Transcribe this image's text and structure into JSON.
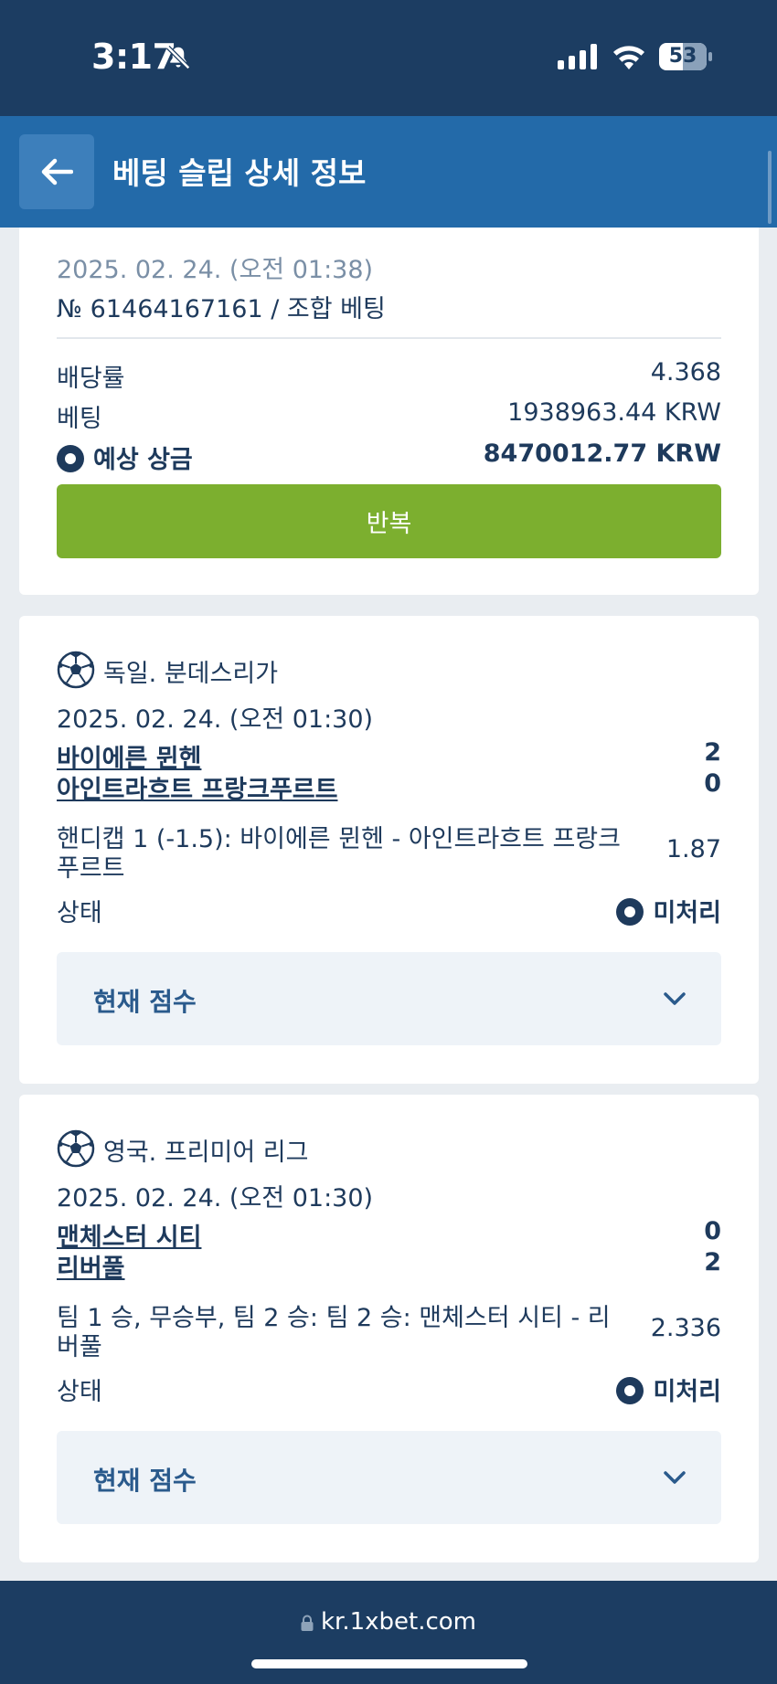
{
  "status_bar": {
    "time": "3:17",
    "battery": "53"
  },
  "nav": {
    "title": "베팅 슬립 상세 정보"
  },
  "summary": {
    "datetime": "2025. 02. 24. (오전 01:38)",
    "bet_number": "№ 61464167161 / 조합 베팅",
    "odds_label": "배당률",
    "odds_value": "4.368",
    "stake_label": "베팅",
    "stake_value": "1938963.44 KRW",
    "payout_label": "예상 상금",
    "payout_value": "8470012.77 KRW",
    "repeat_label": "반복"
  },
  "events": [
    {
      "league": "독일. 분데스리가",
      "datetime": "2025. 02. 24. (오전 01:30)",
      "team1": "바이에른 뮌헨",
      "score1": "2",
      "team2": "아인트라흐트 프랑크푸르트",
      "score2": "0",
      "market_line1": "핸디캡 1 (-1.5): 바이에른 뮌헨 - 아인트라흐트 프랑크",
      "market_line2": "푸르트",
      "odds": "1.87",
      "status_label": "상태",
      "status_value": "미처리",
      "score_toggle": "현재 점수"
    },
    {
      "league": "영국. 프리미어 리그",
      "datetime": "2025. 02. 24. (오전 01:30)",
      "team1": "맨체스터 시티",
      "score1": "0",
      "team2": "리버풀",
      "score2": "2",
      "market_line1": "팀 1 승, 무승부, 팀 2 승: 팀 2 승: 맨체스터 시티 - 리",
      "market_line2": "버풀",
      "odds": "2.336",
      "status_label": "상태",
      "status_value": "미처리",
      "score_toggle": "현재 점수"
    }
  ],
  "browser": {
    "url": "kr.1xbet.com"
  },
  "colors": {
    "header": "#1c3d62",
    "nav": "#236aa9",
    "accent_green": "#7caf2f",
    "text": "#1e3a5c"
  },
  "icons": [
    "bell-slash-icon",
    "signal-icon",
    "wifi-icon",
    "battery-icon",
    "back-arrow-icon",
    "radio-dot-icon",
    "soccer-ball-icon",
    "chevron-down-icon",
    "lock-icon"
  ]
}
